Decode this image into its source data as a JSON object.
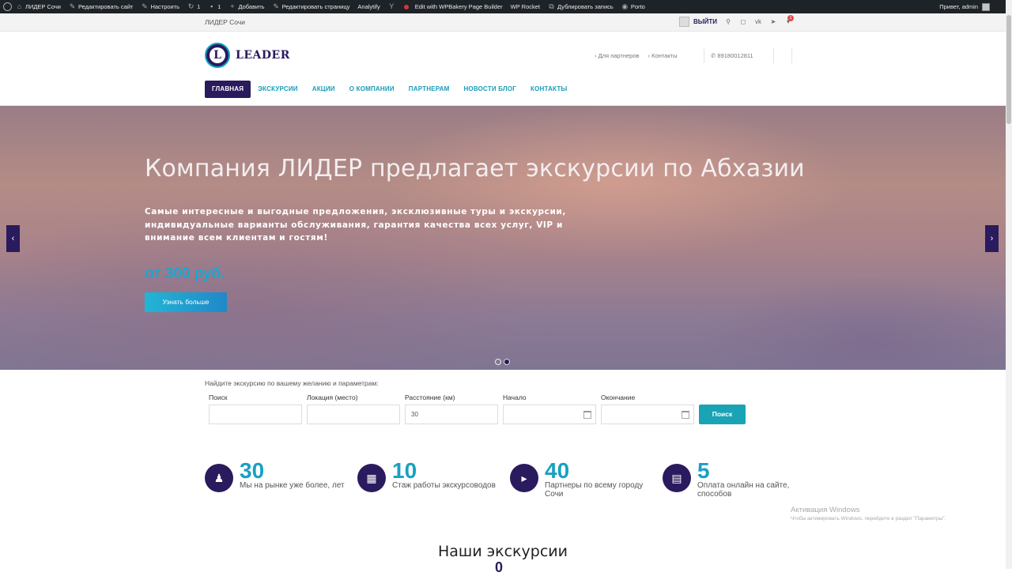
{
  "admin_bar": {
    "items": [
      {
        "icon": "house-icon",
        "label": "ЛИДЕР Сочи"
      },
      {
        "icon": "brush-icon",
        "label": "Редактировать сайт"
      },
      {
        "icon": "brush-icon",
        "label": "Настроить"
      },
      {
        "icon": "refresh-icon",
        "label": "1"
      },
      {
        "icon": "comment-icon",
        "label": "1"
      },
      {
        "icon": "plus-icon",
        "label": "Добавить"
      },
      {
        "icon": "pencil-icon",
        "label": "Редактировать страницу"
      },
      {
        "icon": "",
        "label": "Analytify"
      },
      {
        "icon": "yoast-icon",
        "label": ""
      },
      {
        "icon": "red-dot-icon",
        "label": "Edit with WPBakery Page Builder"
      },
      {
        "icon": "",
        "label": "WP Rocket"
      },
      {
        "icon": "copy-icon",
        "label": "Дублировать запись"
      },
      {
        "icon": "porto-icon",
        "label": "Porto"
      }
    ],
    "greeting": "Привет, admin"
  },
  "top_strip": {
    "site_name": "ЛИДЕР Сочи",
    "logout": "ВЫЙТИ",
    "cart_count": "1"
  },
  "header": {
    "logo_letter": "L",
    "logo_text": "LEADER",
    "links": [
      "Для партнеров",
      "Контакты"
    ],
    "phone": "89180012811"
  },
  "nav": [
    "ГЛАВНАЯ",
    "ЭКСКУРСИИ",
    "АКЦИИ",
    "О КОМПАНИИ",
    "ПАРТНЕРАМ",
    "НОВОСТИ БЛОГ",
    "КОНТАКТЫ"
  ],
  "hero": {
    "title": "Компания ЛИДЕР предлагает экскурсии по Абхазии",
    "subtitle": "Самые интересные и выгодные предложения, эксклюзивные туры и экскурсии, индивидуальные варианты обслуживания, гарантия качества всех услуг, VIP и внимание всем клиентам и гостям!",
    "price": "от 300 руб.",
    "cta": "Узнать больше"
  },
  "search": {
    "lead": "Найдите экскурсию по вашему желанию и параметрам:",
    "fields": [
      {
        "label": "Поиск",
        "value": ""
      },
      {
        "label": "Локация (место)",
        "value": ""
      },
      {
        "label": "Расстояние (км)",
        "value": "30"
      },
      {
        "label": "Начало",
        "value": ""
      },
      {
        "label": "Окончание",
        "value": ""
      }
    ],
    "button": "Поиск"
  },
  "stats": [
    {
      "number": "30",
      "label": "Мы на рынке уже более, лет",
      "icon": "user-icon"
    },
    {
      "number": "10",
      "label": "Стаж работы экскурсоводов",
      "icon": "grid-icon"
    },
    {
      "number": "40",
      "label": "Партнеры по всему городу Сочи",
      "icon": "megaphone-icon"
    },
    {
      "number": "5",
      "label": "Оплата онлайн на сайте, способов",
      "icon": "ticket-icon"
    }
  ],
  "watermark": {
    "line1": "Активация Windows",
    "line2": "Чтобы активировать Windows, перейдите в раздел \"Параметры\"."
  },
  "section": {
    "title": "Наши экскурсии",
    "number": "0"
  },
  "colors": {
    "brand_dark": "#2a1a5e",
    "accent": "#1aa0c2"
  }
}
